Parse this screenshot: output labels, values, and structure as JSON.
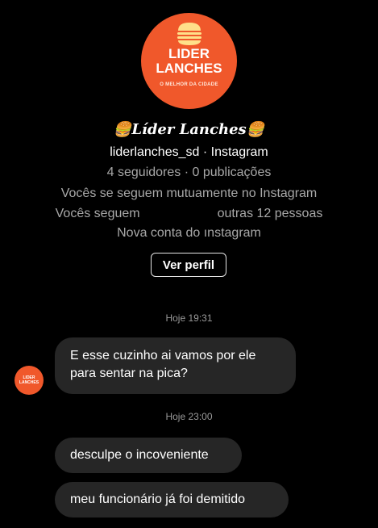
{
  "profile": {
    "logo_line1": "LIDER",
    "logo_line2": "LANCHES",
    "logo_tagline": "O MELHOR DA CIDADE",
    "display_name": "🍔Líder Lanches🍔",
    "handle_line": "liderlanches_sd · Instagram",
    "stats": "4 seguidores · 0 publicações",
    "mutual": "Vocês se seguem mutuamente no Instagram",
    "follows_prefix": "Vocês seguem",
    "follows_suffix": "outras 12 pessoas",
    "new_account": "Nova conta do ınstagram",
    "view_profile_label": "Ver perfil"
  },
  "colors": {
    "background": "#000000",
    "brand_orange": "#f0582b",
    "bubble": "#262626",
    "muted_text": "#a8a8a8"
  },
  "chat": {
    "timestamp1": "Hoje 19:31",
    "timestamp2": "Hoje 23:00",
    "avatar_line1": "LIDER",
    "avatar_line2": "LANCHES",
    "messages": [
      {
        "line1": "E esse cuzinho ai vamos por ele",
        "line2": "para sentar na pica?"
      },
      {
        "text": "desculpe o incoveniente"
      },
      {
        "text": "meu funcionário já foi demitido"
      }
    ]
  }
}
